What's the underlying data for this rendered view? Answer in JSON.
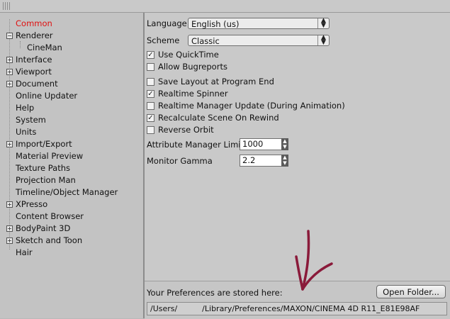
{
  "tree": {
    "items": [
      {
        "label": "Common",
        "expander": "",
        "selected": true,
        "child": false
      },
      {
        "label": "Renderer",
        "expander": "−",
        "selected": false,
        "child": false
      },
      {
        "label": "CineMan",
        "expander": "",
        "selected": false,
        "child": true
      },
      {
        "label": "Interface",
        "expander": "+",
        "selected": false,
        "child": false
      },
      {
        "label": "Viewport",
        "expander": "+",
        "selected": false,
        "child": false
      },
      {
        "label": "Document",
        "expander": "+",
        "selected": false,
        "child": false
      },
      {
        "label": "Online Updater",
        "expander": "",
        "selected": false,
        "child": false
      },
      {
        "label": "Help",
        "expander": "",
        "selected": false,
        "child": false
      },
      {
        "label": "System",
        "expander": "",
        "selected": false,
        "child": false
      },
      {
        "label": "Units",
        "expander": "",
        "selected": false,
        "child": false
      },
      {
        "label": "Import/Export",
        "expander": "+",
        "selected": false,
        "child": false
      },
      {
        "label": "Material Preview",
        "expander": "",
        "selected": false,
        "child": false
      },
      {
        "label": "Texture Paths",
        "expander": "",
        "selected": false,
        "child": false
      },
      {
        "label": "Projection Man",
        "expander": "",
        "selected": false,
        "child": false
      },
      {
        "label": "Timeline/Object Manager",
        "expander": "",
        "selected": false,
        "child": false
      },
      {
        "label": "XPresso",
        "expander": "+",
        "selected": false,
        "child": false
      },
      {
        "label": "Content Browser",
        "expander": "",
        "selected": false,
        "child": false
      },
      {
        "label": "BodyPaint 3D",
        "expander": "+",
        "selected": false,
        "child": false
      },
      {
        "label": "Sketch and Toon",
        "expander": "+",
        "selected": false,
        "child": false
      },
      {
        "label": "Hair",
        "expander": "",
        "selected": false,
        "child": false
      }
    ]
  },
  "settings": {
    "language_label": "Language",
    "language_value": "English (us)",
    "scheme_label": "Scheme",
    "scheme_value": "Classic",
    "checkboxes": [
      {
        "label": "Use QuickTime",
        "checked": true
      },
      {
        "label": "Allow Bugreports",
        "checked": false
      },
      {
        "label": "Save Layout at Program End",
        "checked": false
      },
      {
        "label": "Realtime Spinner",
        "checked": true
      },
      {
        "label": "Realtime Manager Update (During Animation)",
        "checked": false
      },
      {
        "label": "Recalculate Scene On Rewind",
        "checked": true
      },
      {
        "label": "Reverse Orbit",
        "checked": false
      }
    ],
    "attr_limit_label": "Attribute Manager Limit",
    "attr_limit_value": "1000",
    "gamma_label": "Monitor Gamma",
    "gamma_value": "2.2"
  },
  "footer": {
    "stored_label": "Your Preferences are stored here:",
    "open_folder_label": "Open Folder...",
    "path_value": "/Users/          /Library/Preferences/MAXON/CINEMA 4D R11_E81E98AF"
  },
  "colors": {
    "selected_item": "#e01010",
    "annotation_arrow": "#8a1a3a"
  }
}
